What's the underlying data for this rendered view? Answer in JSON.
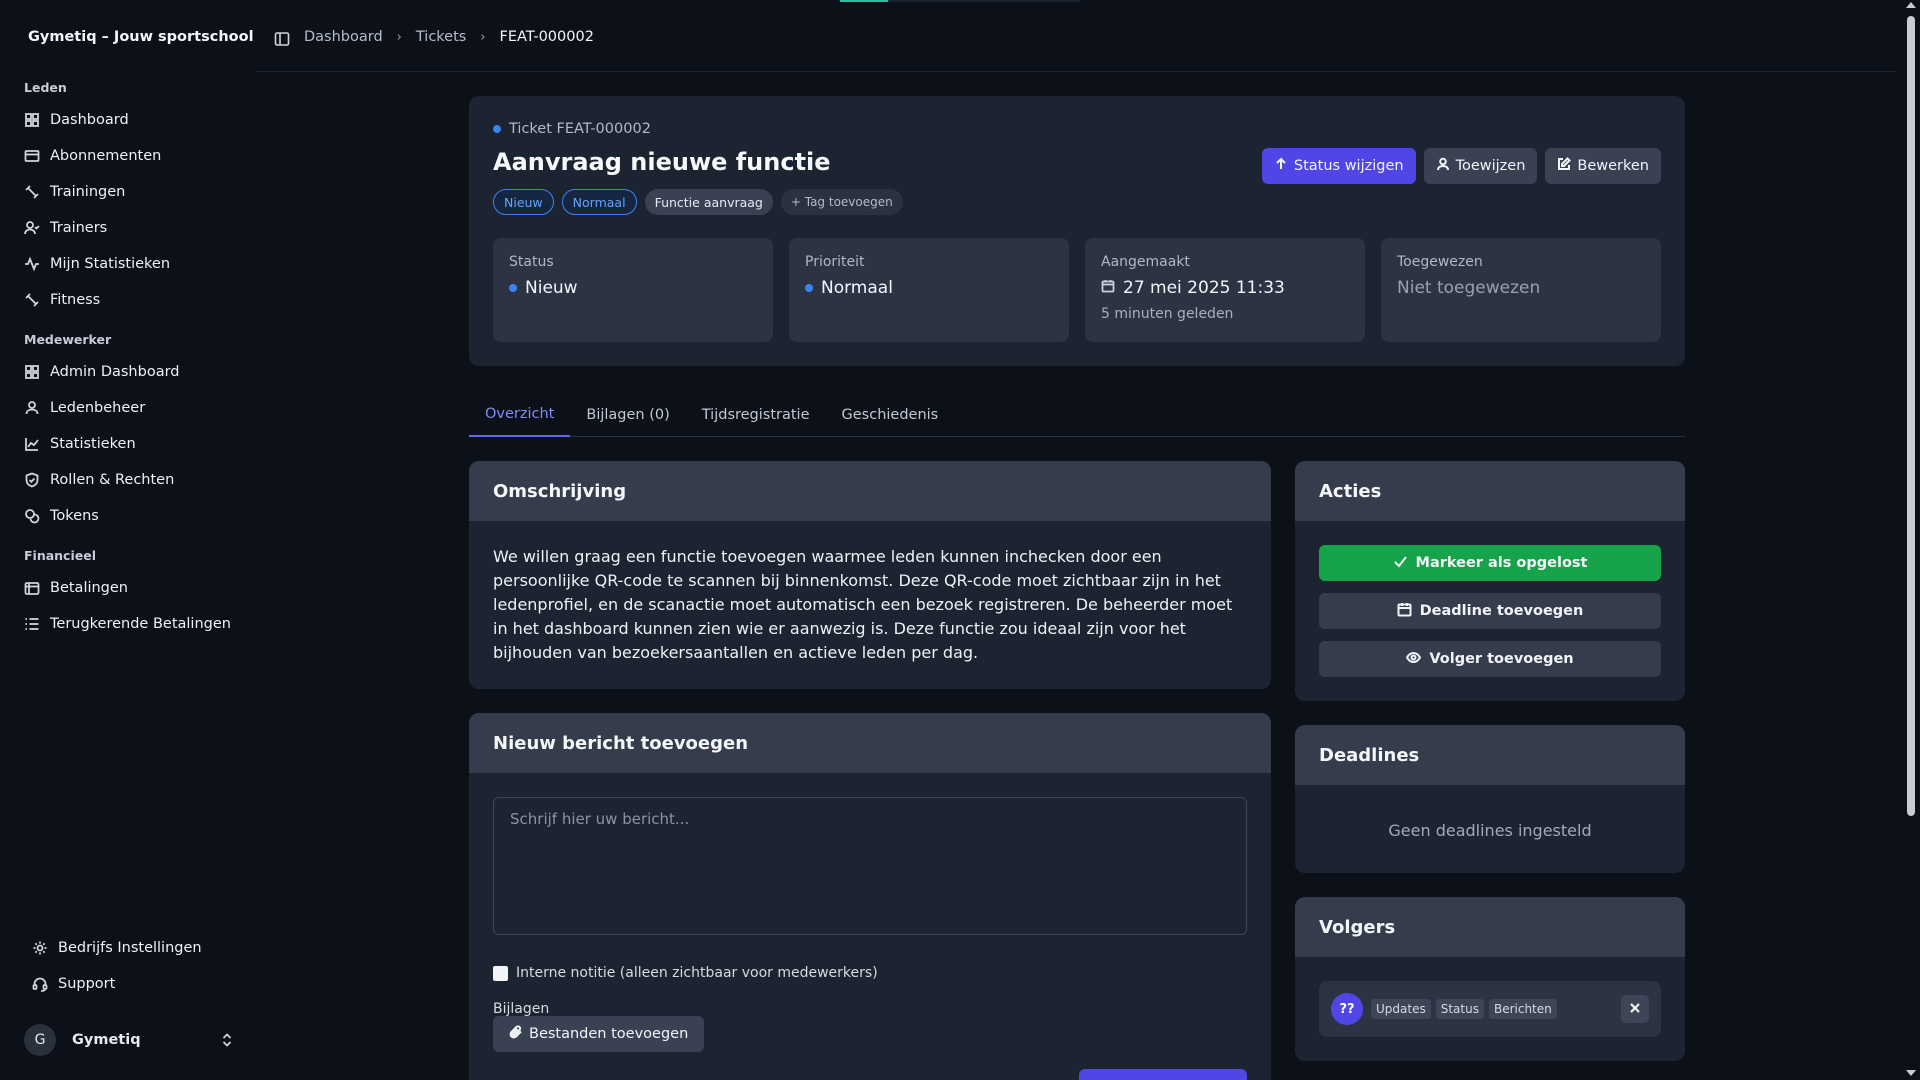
{
  "sidebar": {
    "brand": "Gymetiq – Jouw sportschool",
    "sections": {
      "leden": "Leden",
      "medewerker": "Medewerker",
      "financieel": "Financieel"
    },
    "leden_items": [
      "Dashboard",
      "Abonnementen",
      "Trainingen",
      "Trainers",
      "Mijn Statistieken",
      "Fitness"
    ],
    "medewerker_items": [
      "Admin Dashboard",
      "Ledenbeheer",
      "Statistieken",
      "Rollen & Rechten",
      "Tokens"
    ],
    "financieel_items": [
      "Betalingen",
      "Terugkerende Betalingen"
    ],
    "footer_items": [
      "Bedrijfs Instellingen",
      "Support"
    ],
    "user": {
      "initial": "G",
      "name": "Gymetiq"
    }
  },
  "breadcrumb": {
    "items": [
      "Dashboard",
      "Tickets"
    ],
    "current": "FEAT-000002"
  },
  "ticket": {
    "id_label": "Ticket FEAT-000002",
    "title": "Aanvraag nieuwe functie",
    "tags": {
      "status": "Nieuw",
      "priority": "Normaal",
      "type": "Functie aanvraag",
      "add": "+ Tag toevoegen"
    },
    "actions": {
      "status": "Status wijzigen",
      "assign": "Toewijzen",
      "edit": "Bewerken"
    },
    "info": {
      "status_label": "Status",
      "status_value": "Nieuw",
      "priority_label": "Prioriteit",
      "priority_value": "Normaal",
      "created_label": "Aangemaakt",
      "created_value": "27 mei 2025 11:33",
      "created_sub": "5 minuten geleden",
      "assigned_label": "Toegewezen",
      "assigned_value": "Niet toegewezen"
    }
  },
  "tabs": [
    "Overzicht",
    "Bijlagen (0)",
    "Tijdsregistratie",
    "Geschiedenis"
  ],
  "description": {
    "title": "Omschrijving",
    "text": "We willen graag een functie toevoegen waarmee leden kunnen inchecken door een persoonlijke QR-code te scannen bij binnenkomst. Deze QR-code moet zichtbaar zijn in het ledenprofiel, en de scanactie moet automatisch een bezoek registreren. De beheerder moet in het dashboard kunnen zien wie er aanwezig is. Deze functie zou ideaal zijn voor het bijhouden van bezoekersaantallen en actieve leden per dag."
  },
  "message": {
    "title": "Nieuw bericht toevoegen",
    "placeholder": "Schrijf hier uw bericht...",
    "internal_note": "Interne notitie (alleen zichtbaar voor medewerkers)",
    "attachments_label": "Bijlagen",
    "attach_button": "Bestanden toevoegen"
  },
  "acties": {
    "title": "Acties",
    "resolve": "Markeer als opgelost",
    "deadline": "Deadline toevoegen",
    "follower": "Volger toevoegen"
  },
  "deadlines": {
    "title": "Deadlines",
    "empty": "Geen deadlines ingesteld"
  },
  "volgers": {
    "title": "Volgers",
    "avatar": "??",
    "badges": [
      "Updates",
      "Status",
      "Berichten"
    ]
  },
  "colors": {
    "accent": "#4f46e5",
    "success": "#16a34a",
    "tag_blue": "#3b82f6"
  }
}
